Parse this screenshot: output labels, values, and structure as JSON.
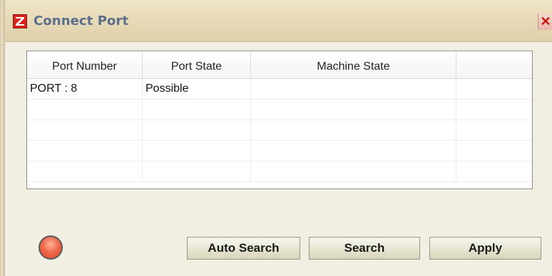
{
  "window": {
    "title": "Connect Port",
    "close_label": "✕",
    "app_icon": "app-logo-z-icon"
  },
  "table": {
    "columns": [
      "Port Number",
      "Port State",
      "Machine State",
      ""
    ],
    "rows": [
      [
        "PORT : 8",
        "Possible",
        "",
        ""
      ],
      [
        "",
        "",
        "",
        ""
      ],
      [
        "",
        "",
        "",
        ""
      ],
      [
        "",
        "",
        "",
        ""
      ],
      [
        "",
        "",
        "",
        ""
      ]
    ]
  },
  "status": {
    "icon": "status-led-icon",
    "color": "#e8553a"
  },
  "buttons": {
    "auto_search": "Auto Search",
    "search": "Search",
    "apply": "Apply"
  }
}
